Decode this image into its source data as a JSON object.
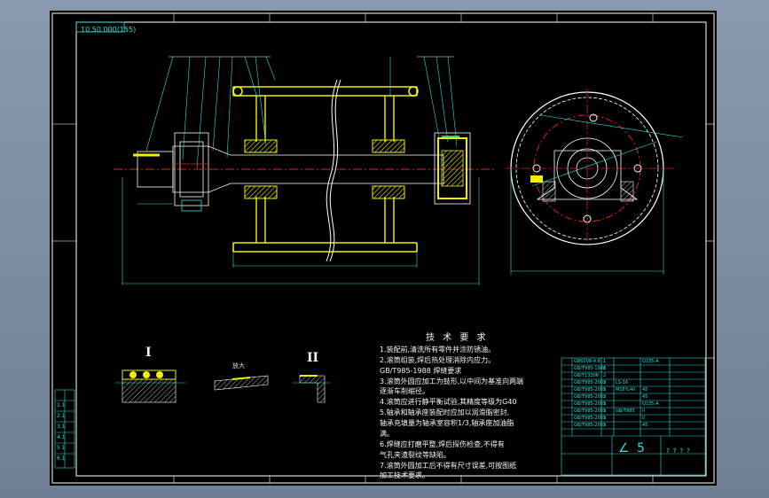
{
  "drawing": {
    "number": "10.50.000(155)",
    "section_I_label": "I",
    "section_II_label": "II",
    "detail_caption": "放大",
    "notes_title": "技 术 要 求",
    "notes": [
      "1.装配前,清洗所有零件并涂防锈油。",
      "2.滚筒组装,焊后热处理消除内应力。",
      "GB/T985-1988 焊缝要求",
      "3.滚筒外圆应加工为鼓形,以中间为基准向两端",
      "逐渐车削缩径。",
      "4.滚筒应进行静平衡试验,其精度等级为G40",
      "5.轴承和轴承座装配时应加以润滑脂密封,",
      "轴承充填量为轴承室容积1/3,轴承座加油脂",
      "满。",
      "6.焊缝应打磨平整,焊后探伤检查,不得有",
      "气孔夹渣裂纹等缺陷。",
      "7.滚筒外圆加工后不得有尺寸误差,可按图纸",
      "加工技术要求。"
    ],
    "title_block": {
      "big_text": "∠ 5",
      "right_text": "????",
      "rows": [
        [
          "GB6008-4.8",
          "1",
          "",
          "Q235-A",
          ""
        ],
        [
          "GB/T985-1988",
          "1",
          "",
          "",
          ""
        ],
        [
          "GB/T13306",
          "2",
          "",
          "",
          ""
        ],
        [
          "GB/T985-2003",
          "2",
          "LS-16",
          "",
          ""
        ],
        [
          "GB/T985-2003",
          "1",
          "M16*L40",
          "45",
          ""
        ],
        [
          "GB/T985-2003",
          "2",
          "",
          "45",
          ""
        ],
        [
          "GB/T985-2003",
          "1",
          "",
          "Q235-A",
          ""
        ],
        [
          "GB/T985-2003",
          "1",
          "GB/T985",
          "II",
          ""
        ],
        [
          "GB/T985-2003",
          "1",
          "",
          "II",
          ""
        ],
        [
          "GB/T985-2003",
          "1",
          "",
          "45",
          ""
        ]
      ]
    },
    "left_margin_labels": [
      "1.1",
      "2.1",
      "3.1",
      "4.1",
      "5.1",
      "6.1"
    ],
    "colors": {
      "background": "#000000",
      "frame": "#ffffff",
      "cyan": "#29e0e0",
      "yellow": "#f0f000",
      "red": "#e02020",
      "green": "#20e020"
    }
  }
}
